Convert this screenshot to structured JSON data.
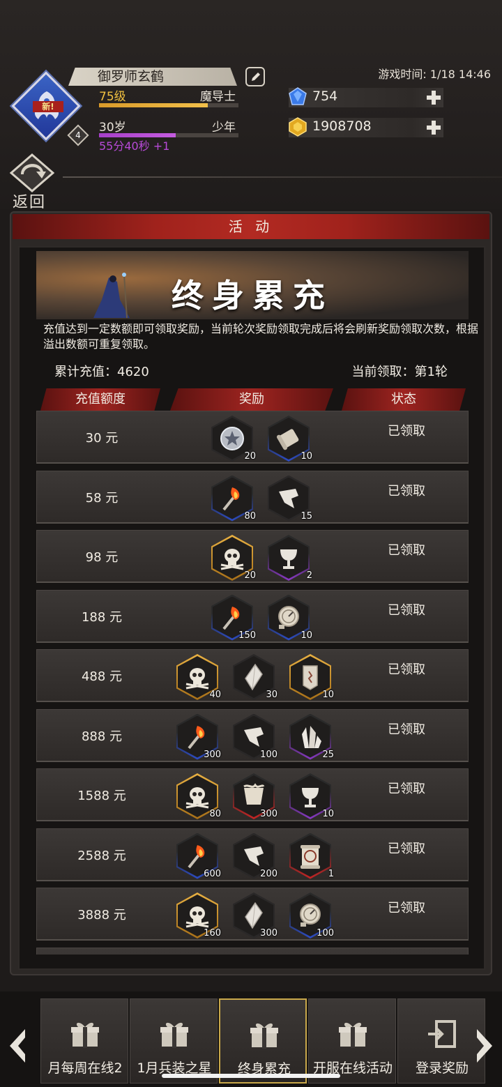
{
  "header": {
    "player_name": "御罗师玄鹤",
    "level_label": "75级",
    "job_label": "魔导士",
    "level_progress": 0.78,
    "age_label": "30岁",
    "age_stage": "少年",
    "age_progress": 0.55,
    "timer_text": "55分40秒 +1",
    "avatar_badge": "新!",
    "avatar_number": "4",
    "game_time": "游戏时间: 1/18 14:46",
    "gems": "754",
    "gold": "1908708",
    "back_label": "返回"
  },
  "panel": {
    "title": "活 动",
    "banner_title": "终身累充",
    "description": "充值达到一定数额即可领取奖励，当前轮次奖励领取完成后将会刷新奖励领取次数，根据溢出数额可重复领取。",
    "total_recharge": "累计充值：4620",
    "current_round": "当前领取：第1轮",
    "columns": [
      "充值额度",
      "奖励",
      "状态"
    ],
    "rows": [
      {
        "amount": "30 元",
        "status": "已领取",
        "rewards": [
          {
            "icon": "silver-coin-icon",
            "quality": "grey",
            "qty": "20"
          },
          {
            "icon": "scroll-icon",
            "quality": "blue",
            "qty": "10"
          }
        ]
      },
      {
        "amount": "58 元",
        "status": "已领取",
        "rewards": [
          {
            "icon": "torch-icon",
            "quality": "blue",
            "qty": "80"
          },
          {
            "icon": "shard-icon",
            "quality": "grey",
            "qty": "15"
          }
        ]
      },
      {
        "amount": "98 元",
        "status": "已领取",
        "rewards": [
          {
            "icon": "skull-icon",
            "quality": "gold",
            "qty": "20"
          },
          {
            "icon": "chalice-icon",
            "quality": "purple",
            "qty": "2"
          }
        ]
      },
      {
        "amount": "188 元",
        "status": "已领取",
        "rewards": [
          {
            "icon": "torch-icon",
            "quality": "blue",
            "qty": "150"
          },
          {
            "icon": "compass-icon",
            "quality": "blue",
            "qty": "10"
          }
        ]
      },
      {
        "amount": "488 元",
        "status": "已领取",
        "rewards": [
          {
            "icon": "skull-icon",
            "quality": "gold",
            "qty": "40"
          },
          {
            "icon": "crystal-icon",
            "quality": "grey",
            "qty": "30"
          },
          {
            "icon": "tablet-icon",
            "quality": "gold",
            "qty": "10"
          }
        ]
      },
      {
        "amount": "888 元",
        "status": "已领取",
        "rewards": [
          {
            "icon": "torch-icon",
            "quality": "blue",
            "qty": "300"
          },
          {
            "icon": "shard-icon",
            "quality": "grey",
            "qty": "100"
          },
          {
            "icon": "crystal-cluster-icon",
            "quality": "purple",
            "qty": "25"
          }
        ]
      },
      {
        "amount": "1588 元",
        "status": "已领取",
        "rewards": [
          {
            "icon": "skull-icon",
            "quality": "gold",
            "qty": "80"
          },
          {
            "icon": "banner-scroll-icon",
            "quality": "red",
            "qty": "300"
          },
          {
            "icon": "chalice-icon",
            "quality": "purple",
            "qty": "10"
          }
        ]
      },
      {
        "amount": "2588 元",
        "status": "已领取",
        "rewards": [
          {
            "icon": "torch-icon",
            "quality": "blue",
            "qty": "600"
          },
          {
            "icon": "shard-icon",
            "quality": "grey",
            "qty": "200"
          },
          {
            "icon": "enhance-scroll-icon",
            "quality": "red",
            "qty": "1"
          }
        ]
      },
      {
        "amount": "3888 元",
        "status": "已领取",
        "rewards": [
          {
            "icon": "skull-icon",
            "quality": "gold",
            "qty": "160"
          },
          {
            "icon": "crystal-icon",
            "quality": "grey",
            "qty": "300"
          },
          {
            "icon": "compass-icon",
            "quality": "blue",
            "qty": "100"
          }
        ]
      }
    ]
  },
  "tabs": [
    {
      "label": "月每周在线2",
      "active": false
    },
    {
      "label": "1月兵装之星",
      "active": false
    },
    {
      "label": "终身累充",
      "active": true
    },
    {
      "label": "开服在线活动",
      "active": false
    },
    {
      "label": "登录奖励",
      "active": false
    }
  ],
  "colors": {
    "accent_red": "#a0221c",
    "gold": "#f0c040",
    "purple": "#b84ad8",
    "active_tab_border": "#c9a84a"
  }
}
